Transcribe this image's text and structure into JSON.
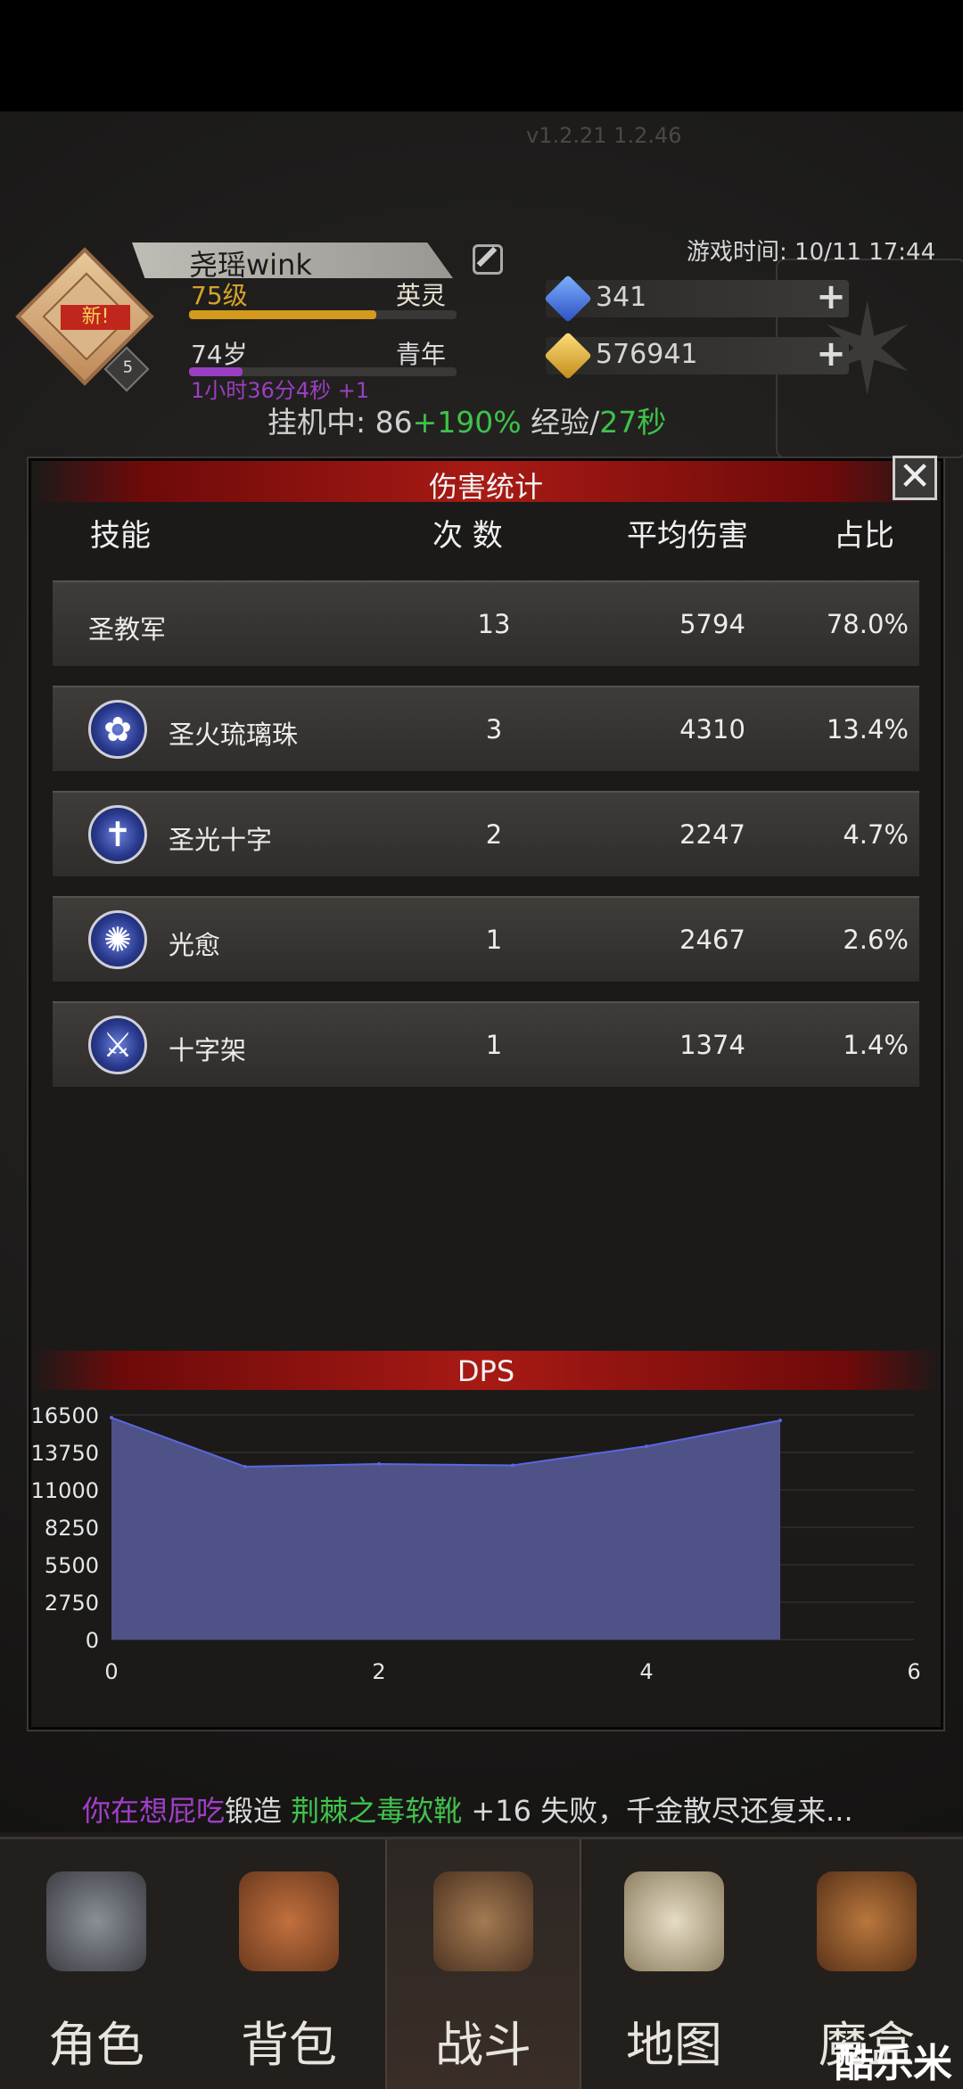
{
  "version": "v1.2.21 1.2.46",
  "player": {
    "name": "尧瑶wink",
    "new_badge": "新!",
    "small_level": "5",
    "level": "75级",
    "rank": "英灵",
    "age": "74岁",
    "stage": "青年",
    "idle_time": "1小时36分4秒 +1",
    "level_progress": 0.7,
    "age_progress": 0.2
  },
  "afk": {
    "prefix": "挂机中: 86",
    "bonus": "+190%",
    "exp_label": " 经验/",
    "exp_rate": "27秒"
  },
  "game_time": "游戏时间: 10/11 17:44",
  "currency": {
    "gems": "341",
    "gold": "576941"
  },
  "modal": {
    "title": "伤害统计",
    "close": "✕",
    "headers": {
      "skill": "技能",
      "count": "次 数",
      "avg": "平均伤害",
      "ratio": "占比"
    },
    "rows": [
      {
        "name": "圣教军",
        "count": "13",
        "avg": "5794",
        "ratio": "78.0%",
        "icon": ""
      },
      {
        "name": "圣火琉璃珠",
        "count": "3",
        "avg": "4310",
        "ratio": "13.4%",
        "icon": "flower-orb-icon"
      },
      {
        "name": "圣光十字",
        "count": "2",
        "avg": "2247",
        "ratio": "4.7%",
        "icon": "holy-cross-icon"
      },
      {
        "name": "光愈",
        "count": "1",
        "avg": "2467",
        "ratio": "2.6%",
        "icon": "heal-ring-icon"
      },
      {
        "name": "十字架",
        "count": "1",
        "avg": "1374",
        "ratio": "1.4%",
        "icon": "sword-icon"
      }
    ],
    "dps_title": "DPS"
  },
  "chart_data": {
    "type": "area",
    "title": "DPS",
    "x": [
      0,
      1,
      2,
      3,
      4,
      5
    ],
    "values": [
      16300,
      12700,
      12900,
      12800,
      14200,
      16100
    ],
    "yticks": [
      0,
      2750,
      5500,
      8250,
      11000,
      13750,
      16500
    ],
    "xticks": [
      0,
      2,
      4,
      6
    ],
    "ylim": [
      0,
      16500
    ],
    "xlim": [
      0,
      6
    ],
    "fill_color": "#4e5287",
    "line_color": "#5b66e0"
  },
  "ticker": {
    "player": "你在想屁吃",
    "action": "锻造 ",
    "item": "荆棘之毒软靴",
    "result": " +16 失败，千金散尽还复来...",
    "tail": ""
  },
  "nav": {
    "items": [
      {
        "label": "角色",
        "icon": "helmet-icon"
      },
      {
        "label": "背包",
        "icon": "backpack-icon"
      },
      {
        "label": "战斗",
        "icon": "sword-shield-icon"
      },
      {
        "label": "地图",
        "icon": "scroll-map-icon"
      },
      {
        "label": "魔盒",
        "icon": "magic-box-icon"
      }
    ]
  },
  "watermark": "酷乐米"
}
